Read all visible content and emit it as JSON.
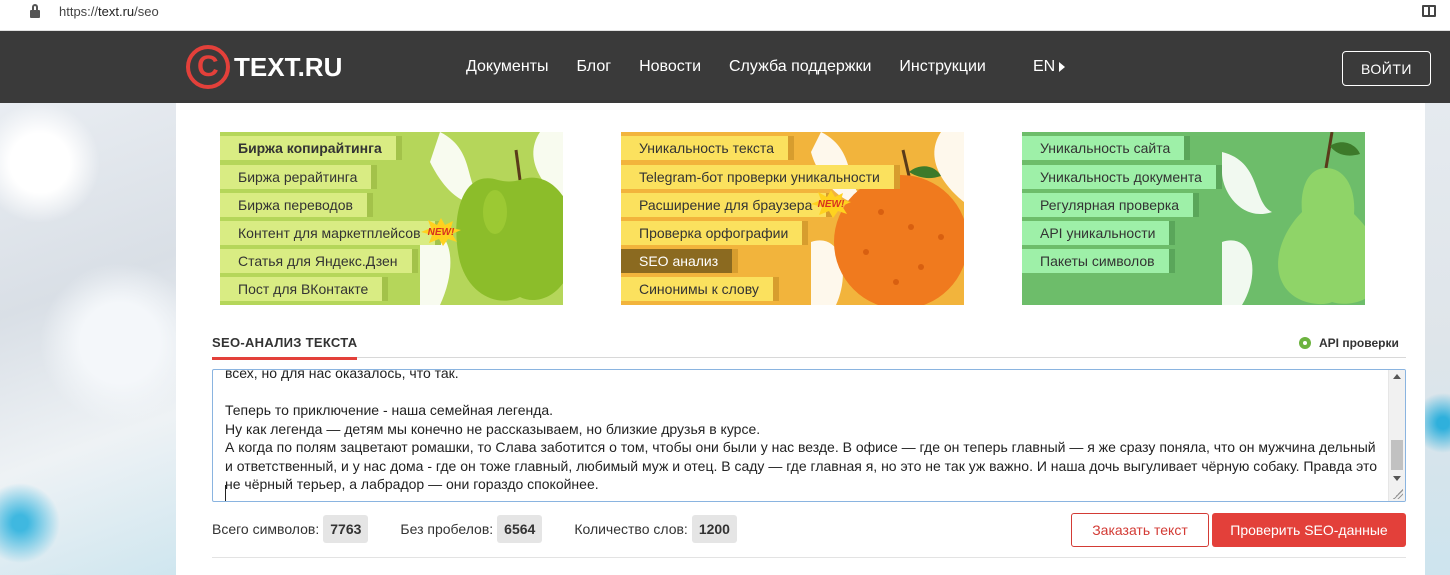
{
  "browser": {
    "url_scheme": "https://",
    "url_host": "text.ru",
    "url_path": "/seo"
  },
  "header": {
    "logo_text": "TEXT.RU",
    "nav": [
      "Документы",
      "Блог",
      "Новости",
      "Служба поддержки",
      "Инструкции"
    ],
    "lang": "EN",
    "login": "ВОЙТИ"
  },
  "cards": {
    "copywriting": [
      "Биржа копирайтинга",
      "Биржа рерайтинга",
      "Биржа переводов",
      "Контент для маркетплейсов",
      "Статья для Яндекс.Дзен",
      "Пост для ВКонтакте"
    ],
    "tools": [
      "Уникальность текста",
      "Telegram-бот проверки уникальности",
      "Расширение для браузера",
      "Проверка орфографии",
      "SEO анализ",
      "Синонимы к слову"
    ],
    "site": [
      "Уникальность сайта",
      "Уникальность документа",
      "Регулярная проверка",
      "API уникальности",
      "Пакеты символов"
    ],
    "new_badge": "NEW!"
  },
  "seo": {
    "title": "SEO-АНАЛИЗ ТЕКСТА",
    "api_link": "API проверки",
    "text": "всех, но для нас оказалось, что так.\n\nТеперь то приключение - наша семейная легенда.\nНу как легенда — детям мы конечно не рассказываем, но близкие друзья в курсе.\nА когда по полям зацветают ромашки, то Слава заботится о том, чтобы они были у нас везде. В офисе — где он теперь главный — я же сразу поняла, что он мужчина дельный и ответственный, и у нас дома - где он тоже главный, любимый муж и отец. В саду — где главная я, но это не так уж важно. И наша дочь выгуливает чёрную собаку. Правда это не чёрный терьер, а лабрадор — они гораздо спокойнее.",
    "total_label": "Всего символов:",
    "total_value": "7763",
    "nospace_label": "Без пробелов:",
    "nospace_value": "6564",
    "words_label": "Количество слов:",
    "words_value": "1200",
    "order_button": "Заказать текст",
    "check_button": "Проверить SEO-данные"
  },
  "colors": {
    "accent": "#e3403a",
    "header_bg": "#3a3a3a",
    "active_item": "#8b6a20"
  }
}
